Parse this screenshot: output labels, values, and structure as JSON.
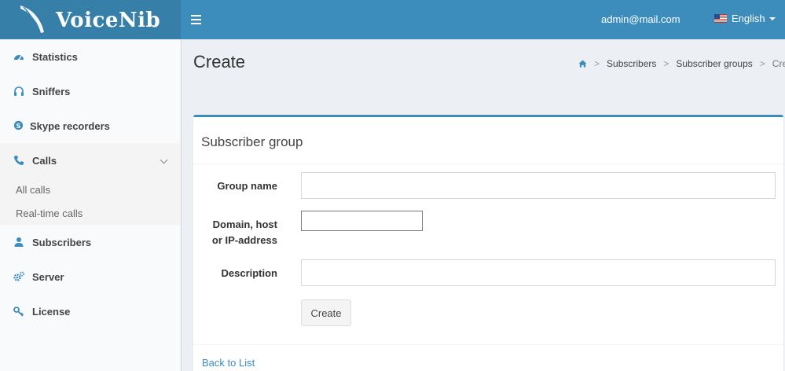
{
  "header": {
    "logo_text": "VoiceNib",
    "user_email": "admin@mail.com",
    "language": "English"
  },
  "sidebar": {
    "items": [
      {
        "label": "Statistics",
        "icon": "dashboard-icon"
      },
      {
        "label": "Sniffers",
        "icon": "headphones-icon"
      },
      {
        "label": "Skype recorders",
        "icon": "skype-icon"
      },
      {
        "label": "Calls",
        "icon": "phone-icon"
      },
      {
        "label": "Subscribers",
        "icon": "user-icon"
      },
      {
        "label": "Server",
        "icon": "gears-icon"
      },
      {
        "label": "License",
        "icon": "key-icon"
      }
    ],
    "calls_submenu": [
      "All calls",
      "Real-time calls"
    ]
  },
  "page": {
    "title": "Create",
    "breadcrumb": [
      "Subscribers",
      "Subscriber groups",
      "Create"
    ]
  },
  "form": {
    "box_title": "Subscriber group",
    "group_name_label": "Group name",
    "group_name_value": "",
    "domain_label_line1": "Domain, host",
    "domain_label_line2": "or IP-address",
    "domain_value": "",
    "description_label": "Description",
    "description_value": "",
    "create_button": "Create",
    "back_link": "Back to List"
  },
  "colors": {
    "header": "#3c8dbc",
    "logo_bg": "#367fa9",
    "accent": "#3c8dbc"
  }
}
